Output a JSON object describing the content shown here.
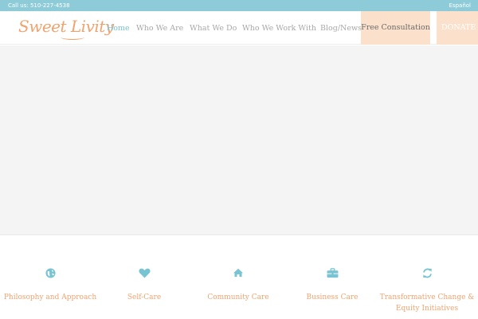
{
  "topbar": {
    "phone": "Call us: 510-227-4538",
    "language_link": "Español"
  },
  "header": {
    "logo_text": "Sweet Livity",
    "nav": [
      {
        "label": "Home",
        "active": true
      },
      {
        "label": "Who We Are"
      },
      {
        "label": "What We Do"
      },
      {
        "label": "Who We Work With"
      },
      {
        "label": "Blog/News"
      },
      {
        "label": "Free Consultation"
      },
      {
        "label": "DONATE"
      }
    ]
  },
  "features": [
    {
      "label": "Philosophy and Approach",
      "icon": "globe-icon"
    },
    {
      "label": "Self-Care",
      "icon": "heart-icon"
    },
    {
      "label": "Community Care",
      "icon": "home-icon"
    },
    {
      "label": "Business Care",
      "icon": "briefcase-icon"
    },
    {
      "label": "Transformative Change & Equity Initiatives",
      "icon": "refresh-icon"
    }
  ],
  "colors": {
    "topbar_bg": "#8ecbd8",
    "accent_orange": "#f0a36f",
    "accent_teal": "#79c4d2",
    "cta_bg": "#fbe1cc",
    "hero_bg": "#f4f4f4"
  }
}
